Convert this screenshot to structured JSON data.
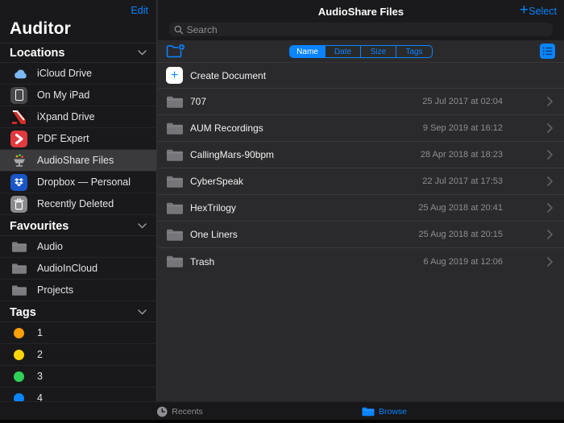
{
  "colors": {
    "accent": "#0a84ff"
  },
  "glyphs": {
    "plus": "+"
  },
  "sidebar": {
    "edit_label": "Edit",
    "title": "Auditor",
    "selected_item": "AudioShare Files",
    "sections": [
      {
        "label": "Locations",
        "items": [
          {
            "label": "iCloud Drive",
            "icon": "icloud-drive-icon"
          },
          {
            "label": "On My iPad",
            "icon": "ipad-icon"
          },
          {
            "label": "iXpand Drive",
            "icon": "ixpand-icon"
          },
          {
            "label": "PDF Expert",
            "icon": "pdf-expert-icon"
          },
          {
            "label": "AudioShare Files",
            "icon": "audioshare-icon"
          },
          {
            "label": "Dropbox — Personal",
            "icon": "dropbox-icon"
          },
          {
            "label": "Recently Deleted",
            "icon": "trash-icon"
          }
        ]
      },
      {
        "label": "Favourites",
        "items": [
          {
            "label": "Audio",
            "icon": "folder-icon"
          },
          {
            "label": "AudioInCloud",
            "icon": "folder-icon"
          },
          {
            "label": "Projects",
            "icon": "folder-icon"
          }
        ]
      },
      {
        "label": "Tags",
        "items": [
          {
            "label": "1",
            "color": "#ff9f0a"
          },
          {
            "label": "2",
            "color": "#ffd60a"
          },
          {
            "label": "3",
            "color": "#30d158"
          },
          {
            "label": "4",
            "color": "#0a84ff"
          }
        ]
      }
    ]
  },
  "main": {
    "header": {
      "title": "AudioShare Files",
      "select_label": "Select"
    },
    "search": {
      "placeholder": "Search"
    },
    "toolbar": {
      "sort_options": [
        "Name",
        "Date",
        "Size",
        "Tags"
      ],
      "selected_sort": "Name"
    },
    "create_row": {
      "label": "Create Document"
    },
    "files": [
      {
        "name": "707",
        "modified": "25 Jul 2017 at 02:04"
      },
      {
        "name": "AUM Recordings",
        "modified": "9 Sep 2019 at 16:12"
      },
      {
        "name": "CallingMars-90bpm",
        "modified": "28 Apr 2018 at 18:23"
      },
      {
        "name": "CyberSpeak",
        "modified": "22 Jul 2017 at 17:53"
      },
      {
        "name": "HexTrilogy",
        "modified": "25 Aug 2018 at 20:41"
      },
      {
        "name": "One Liners",
        "modified": "25 Aug 2018 at 20:15"
      },
      {
        "name": "Trash",
        "modified": "6 Aug 2019 at 12:06"
      }
    ]
  },
  "tabbar": {
    "tabs": [
      {
        "label": "Recents",
        "active": false
      },
      {
        "label": "Browse",
        "active": true
      }
    ]
  }
}
